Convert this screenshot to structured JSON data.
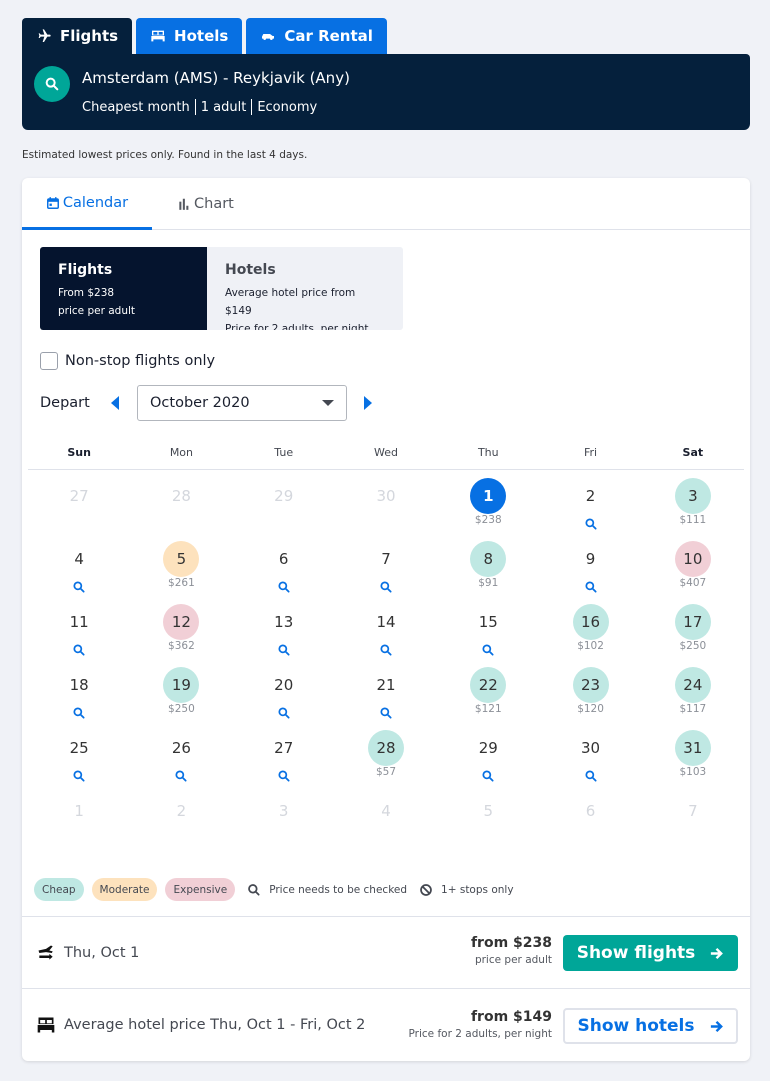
{
  "product_tabs": [
    {
      "label": "Flights",
      "icon": "plane-icon",
      "active": true
    },
    {
      "label": "Hotels",
      "icon": "bed-icon",
      "active": false
    },
    {
      "label": "Car Rental",
      "icon": "car-icon",
      "active": false
    }
  ],
  "search": {
    "route": "Amsterdam (AMS) - Reykjavik (Any)",
    "when": "Cheapest month",
    "travellers": "1 adult",
    "cabin": "Economy"
  },
  "disclaimer": "Estimated lowest prices only. Found in the last 4 days.",
  "view_tabs": [
    {
      "label": "Calendar",
      "icon": "calendar-icon",
      "active": true
    },
    {
      "label": "Chart",
      "icon": "bar-chart-icon",
      "active": false
    }
  ],
  "modes": {
    "flights": {
      "title": "Flights",
      "line1": "From $238",
      "line2": "price per adult",
      "active": true
    },
    "hotels": {
      "title": "Hotels",
      "line1": "Average hotel price from $149",
      "line2": "Price for 2 adults, per night",
      "active": false
    }
  },
  "nonstop": {
    "label": "Non-stop flights only",
    "checked": false
  },
  "depart": {
    "label": "Depart",
    "month": "October 2020"
  },
  "weekdays": [
    "Sun",
    "Mon",
    "Tue",
    "Wed",
    "Thu",
    "Fri",
    "Sat"
  ],
  "days": [
    {
      "d": "27",
      "state": "muted"
    },
    {
      "d": "28",
      "state": "muted"
    },
    {
      "d": "29",
      "state": "muted"
    },
    {
      "d": "30",
      "state": "muted"
    },
    {
      "d": "1",
      "state": "selected",
      "price": "$238"
    },
    {
      "d": "2",
      "state": "check"
    },
    {
      "d": "3",
      "state": "cheap",
      "price": "$111"
    },
    {
      "d": "4",
      "state": "check"
    },
    {
      "d": "5",
      "state": "moderate",
      "price": "$261"
    },
    {
      "d": "6",
      "state": "check"
    },
    {
      "d": "7",
      "state": "check"
    },
    {
      "d": "8",
      "state": "cheap",
      "price": "$91"
    },
    {
      "d": "9",
      "state": "check"
    },
    {
      "d": "10",
      "state": "expensive",
      "price": "$407"
    },
    {
      "d": "11",
      "state": "check"
    },
    {
      "d": "12",
      "state": "expensive",
      "price": "$362"
    },
    {
      "d": "13",
      "state": "check"
    },
    {
      "d": "14",
      "state": "check"
    },
    {
      "d": "15",
      "state": "check"
    },
    {
      "d": "16",
      "state": "cheap",
      "price": "$102"
    },
    {
      "d": "17",
      "state": "cheap",
      "price": "$250"
    },
    {
      "d": "18",
      "state": "check"
    },
    {
      "d": "19",
      "state": "cheap",
      "price": "$250"
    },
    {
      "d": "20",
      "state": "check"
    },
    {
      "d": "21",
      "state": "check"
    },
    {
      "d": "22",
      "state": "cheap",
      "price": "$121"
    },
    {
      "d": "23",
      "state": "cheap",
      "price": "$120"
    },
    {
      "d": "24",
      "state": "cheap",
      "price": "$117"
    },
    {
      "d": "25",
      "state": "check"
    },
    {
      "d": "26",
      "state": "check"
    },
    {
      "d": "27",
      "state": "check"
    },
    {
      "d": "28",
      "state": "cheap",
      "price": "$57"
    },
    {
      "d": "29",
      "state": "check"
    },
    {
      "d": "30",
      "state": "check"
    },
    {
      "d": "31",
      "state": "cheap",
      "price": "$103"
    },
    {
      "d": "1",
      "state": "muted"
    },
    {
      "d": "2",
      "state": "muted"
    },
    {
      "d": "3",
      "state": "muted"
    },
    {
      "d": "4",
      "state": "muted"
    },
    {
      "d": "5",
      "state": "muted"
    },
    {
      "d": "6",
      "state": "muted"
    },
    {
      "d": "7",
      "state": "muted"
    }
  ],
  "legend": {
    "cheap": "Cheap",
    "moderate": "Moderate",
    "expensive": "Expensive",
    "check": "Price needs to be checked",
    "stops": "1+ stops only"
  },
  "flights_row": {
    "date": "Thu, Oct 1",
    "from": "from $238",
    "sub": "price per adult",
    "cta": "Show flights"
  },
  "hotels_row": {
    "date": "Average hotel price  Thu, Oct 1 - Fri, Oct 2",
    "from": "from $149",
    "sub": "Price for 2 adults, per night",
    "cta": "Show hotels"
  },
  "colors": {
    "brand_dark": "#05203c",
    "brand_blue": "#0770e3",
    "teal": "#00a698",
    "cheap": "#bfe8e3",
    "moderate": "#fde2bd",
    "expensive": "#f1cfd6"
  }
}
